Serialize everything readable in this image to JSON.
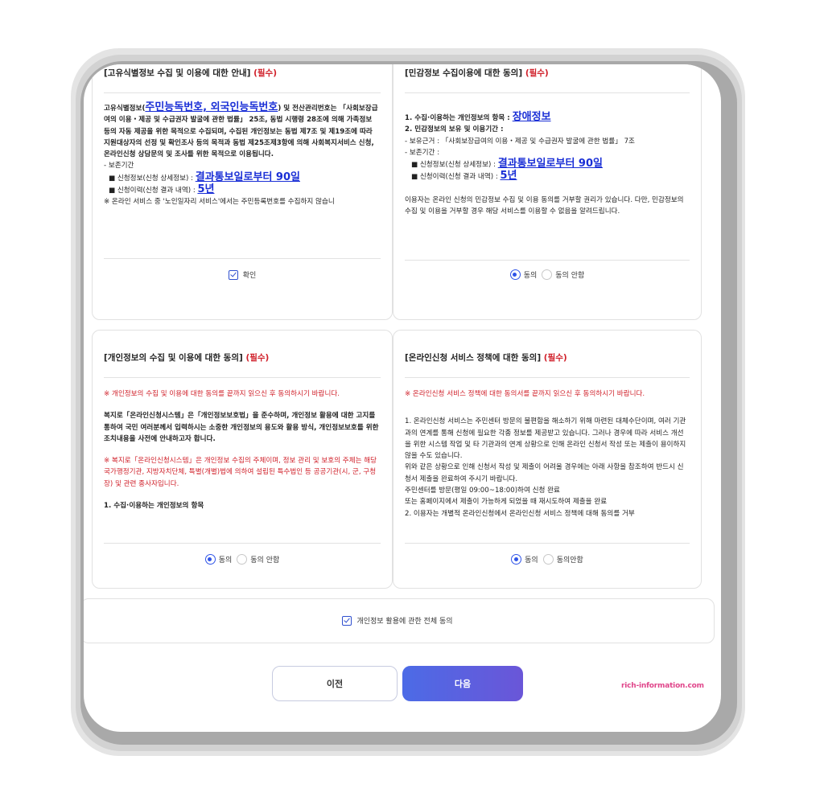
{
  "panel1": {
    "title": "[고유식별정보 수집 및 이용에 대한 안내]",
    "required": "(필수)",
    "p1_a": "고유식별정보(",
    "p1_link": "주민능독번호, 외국인능독번호",
    "p1_b": ") 및 전산관리번호는 「사회보장급여의 이용・제공 및 수급권자 발굴에 관한 법률」 25조, 동법 시행령 28조에 의해 가족정보 등의 자동 제공을 위한 목적으로 수집되며, 수집된 개인정보는 동법 제7조 및 제19조에 따라 지원대상자의 선정 및 확인조사 등의 목적과 동법 제25조제3항에 의해 사회복지서비스 신청, 온라인신청 상담문의 및 조사를 위한 목적으로 이용됩니다.",
    "retention_label": "- 보존기간",
    "item1_label": "■ 신청정보(신청 상세정보) :",
    "item1_value": "결과통보일로부터 90일",
    "item2_label": "■ 신청이력(신청 결과 내역) :",
    "item2_value": "5년",
    "note": "※ 온라인 서비스 중 '노인일자리 서비스'에서는 주민등록번호를 수집하지 않습니",
    "confirm_label": "확인"
  },
  "panel2": {
    "title": "[민감정보 수집이용에 대한 동의]",
    "required": "(필수)",
    "item1_a": "1. 수집·이용하는 개인정보의 항목 :",
    "item1_link": "장애정보",
    "item2": "2. 민감정보의 보유 및 이용기간 :",
    "basis": "- 보유근거 : 「사회보장급여의 이용・제공 및 수급권자 발굴에 관한 법률」 7조",
    "retention_label": "- 보존기간 :",
    "r1_label": "■ 신청정보(신청 상세정보) :",
    "r1_value": "결과통보일로부터 90일",
    "r2_label": "■ 신청이력(신청 결과 내역) :",
    "r2_value": "5년",
    "notice": "이용자는 온라인 신청의 민감정보 수집 및 이용 동의를 거부할 권리가 있습니다. 다만, 민감정보의 수집 및 이용을 거부할 경우 해당 서비스를 이용할 수 없음을 알려드립니다.",
    "agree": "동의",
    "disagree": "동의 안함"
  },
  "panel3": {
    "title": "[개인정보의 수집 및 이용에 대한 동의]",
    "required": "(필수)",
    "red_intro": "※ 개인정보의 수집 및 이용에 대한 동의를 끝까지 읽으신 후 동의하시기 바랍니다.",
    "para1": "복지로「온라인신청시스템」은「개인정보보호법」을 준수하며, 개인정보 활용에 대한 고지를 통하여 국민 여러분께서 입력하시는 소중한 개인정보의 용도와 활용 방식, 개인정보보호를 위한 조치내용을 사전에 안내하고자 합니다.",
    "red_para": "※ 복지로「온라인신청시스템」은 개인정보 수집의 주체이며, 정보 관리 및 보호의 주체는 해당 국가행정기관, 지방자치단체, 특별(개별)법에 의하여 설립된 특수법인 등 공공기관(시, 군, 구청장) 및 관련 종사자입니다.",
    "item1": "1. 수집·이용하는 개인정보의 항목",
    "agree": "동의",
    "disagree": "동의 안함"
  },
  "panel4": {
    "title": "[온라인신청 서비스 정책에 대한 동의]",
    "required": "(필수)",
    "red_intro": "※ 온라인신청 서비스 정책에 대한 동의서를 끝까지 읽으신 후 동의하시기 바랍니다.",
    "para1": "1. 온라인신청 서비스는 주민센터 방문의 불편함을 해소하기 위해 마련된 대체수단이며, 여러 기관과의 연계를 통해 신청에 필요한 각종 정보를 제공받고 있습니다. 그러나 경우에 따라 서비스 개선을 위한 시스템 작업 및 타 기관과의 연계 상황으로 인해 온라인 신청서 작성 또는 제출이 용이하지 않을 수도 있습니다.",
    "para2": "위와 같은 상황으로 인해 신청서 작성 및 제출이 어려울 경우에는 아래 사항을 참조하여 반드시 신청서 제출을 완료하여 주시기 바랍니다.",
    "line1": "주민센터를 방문(평일 09:00~18:00)하여 신청 완료",
    "line2": "또는 홈페이지에서 제출이 가능하게 되었을 때 재시도하여 제출을 완료",
    "line3": "2. 이용자는 개별적 온라인신청에서 온라인신청 서비스 정책에 대해 동의를 거부",
    "agree": "동의",
    "disagree": "동의안함"
  },
  "all_agree": "개인정보 활용에 관한 전체 동의",
  "buttons": {
    "prev": "이전",
    "next": "다음"
  },
  "watermark": "rich-information.com",
  "colors": {
    "accent": "#2f54e8",
    "required": "#d0202a",
    "link": "#1a2fd6"
  }
}
